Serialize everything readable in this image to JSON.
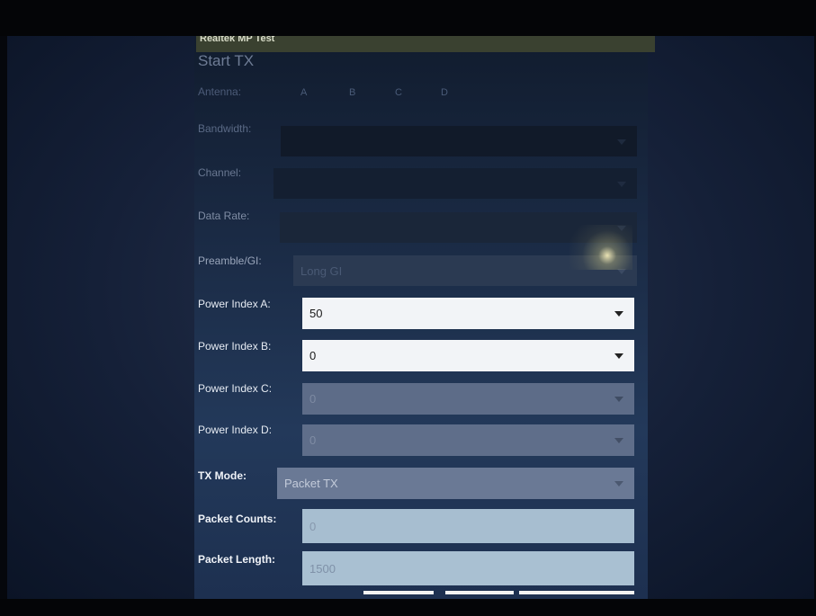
{
  "window": {
    "title": "Realtek MP Test"
  },
  "page": {
    "heading": "Start TX"
  },
  "antenna": {
    "label": "Antenna:",
    "options": [
      "A",
      "B",
      "C",
      "D"
    ]
  },
  "fields": {
    "bandwidth": {
      "label": "Bandwidth:",
      "value": ""
    },
    "channel": {
      "label": "Channel:",
      "value": ""
    },
    "data_rate": {
      "label": "Data Rate:",
      "value": ""
    },
    "preamble_gi": {
      "label": "Preamble/GI:",
      "value": "Long GI"
    },
    "power_index_a": {
      "label": "Power Index A:",
      "value": "50"
    },
    "power_index_b": {
      "label": "Power Index B:",
      "value": "0"
    },
    "power_index_c": {
      "label": "Power Index C:",
      "value": "0"
    },
    "power_index_d": {
      "label": "Power Index D:",
      "value": "0"
    },
    "tx_mode": {
      "label": "TX Mode:",
      "value": "Packet TX"
    },
    "packet_counts": {
      "label": "Packet Counts:",
      "value": "0"
    },
    "packet_length": {
      "label": "Packet Length:",
      "value": "1500"
    }
  },
  "icons": {
    "dropdown": "chevron-down-icon"
  }
}
